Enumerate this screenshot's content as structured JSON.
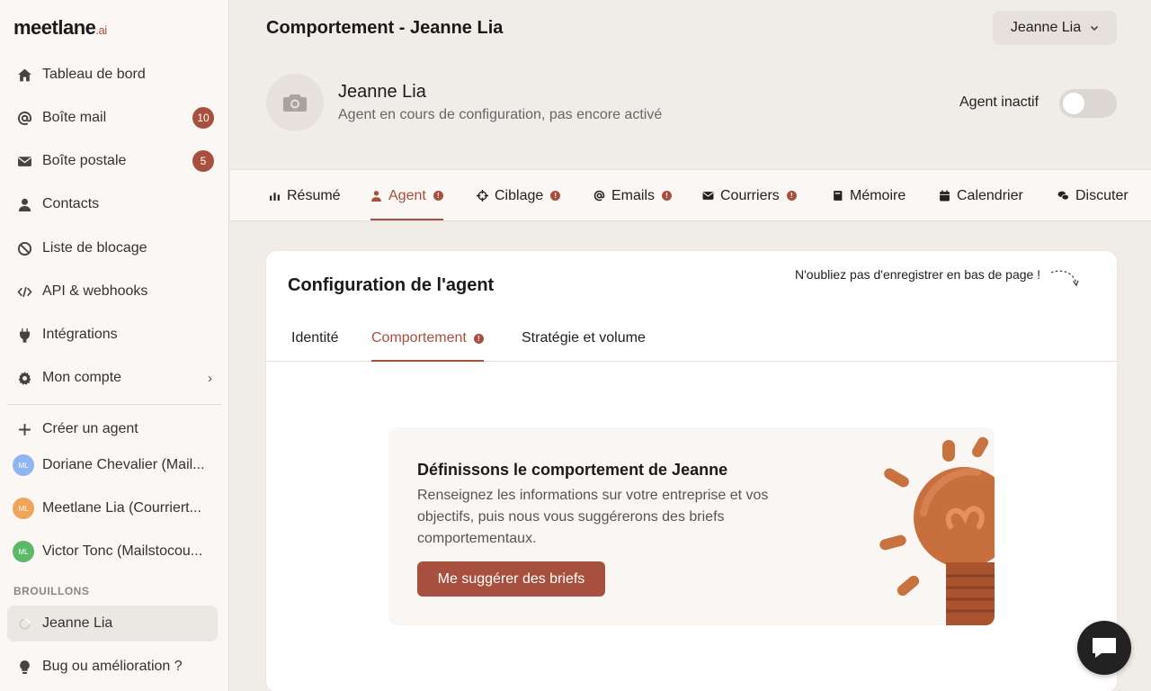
{
  "logo": {
    "main": "meetlane",
    "suffix": ".ai"
  },
  "sidebar": {
    "items": [
      {
        "label": "Tableau de bord",
        "icon": "home-icon"
      },
      {
        "label": "Boîte mail",
        "icon": "at-icon",
        "badge": "10"
      },
      {
        "label": "Boîte postale",
        "icon": "envelope-icon",
        "badge": "5"
      },
      {
        "label": "Contacts",
        "icon": "user-icon"
      },
      {
        "label": "Liste de blocage",
        "icon": "ban-icon"
      },
      {
        "label": "API & webhooks",
        "icon": "code-icon"
      },
      {
        "label": "Intégrations",
        "icon": "plug-icon"
      },
      {
        "label": "Mon compte",
        "icon": "gear-icon",
        "chevron": "›"
      }
    ],
    "create_agent": "Créer un agent",
    "agents": [
      {
        "initials": "ML",
        "label": "Doriane Chevalier (Mail...",
        "color": "#8fb6f0"
      },
      {
        "initials": "ML",
        "label": "Meetlane Lia (Courriert...",
        "color": "#f0a45a"
      },
      {
        "initials": "ML",
        "label": "Victor Tonc (Mailstocou...",
        "color": "#5cb96a"
      }
    ],
    "drafts_label": "BROUILLONS",
    "draft": "Jeanne Lia",
    "feedback": "Bug ou amélioration ?"
  },
  "header": {
    "title": "Comportement - Jeanne Lia",
    "user_select": "Jeanne Lia",
    "agent_name": "Jeanne Lia",
    "agent_status": "Agent en cours de configuration, pas encore activé",
    "inactive_label": "Agent inactif",
    "toggle_on": false
  },
  "tabs": [
    {
      "label": "Résumé",
      "icon": "bar-chart-icon",
      "warn": false
    },
    {
      "label": "Agent",
      "icon": "user-icon",
      "warn": true,
      "active": true
    },
    {
      "label": "Ciblage",
      "icon": "crosshair-icon",
      "warn": true
    },
    {
      "label": "Emails",
      "icon": "at-icon",
      "warn": true
    },
    {
      "label": "Courriers",
      "icon": "envelope-icon",
      "warn": true
    },
    {
      "label": "Mémoire",
      "icon": "book-icon",
      "warn": false
    },
    {
      "label": "Calendrier",
      "icon": "calendar-icon",
      "warn": false
    },
    {
      "label": "Discuter",
      "icon": "chat-icon",
      "warn": false
    }
  ],
  "card": {
    "title": "Configuration de l'agent",
    "reminder": "N'oubliez pas d'enregistrer en bas de page !",
    "subtabs": [
      {
        "label": "Identité"
      },
      {
        "label": "Comportement",
        "warn": true,
        "active": true
      },
      {
        "label": "Stratégie et volume"
      }
    ],
    "promo": {
      "title": "Définissons le comportement de Jeanne",
      "text": "Renseignez les informations sur votre entreprise et vos objectifs, puis nous vous suggérerons des briefs comportementaux.",
      "button": "Me suggérer des briefs"
    }
  },
  "colors": {
    "accent": "#a8503f",
    "background": "#f0ece8",
    "sidebar": "#faf7f5"
  }
}
